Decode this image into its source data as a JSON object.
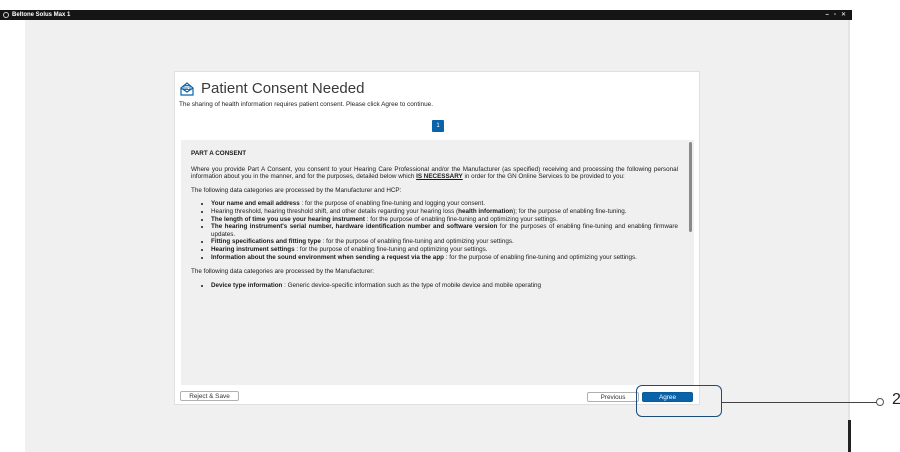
{
  "window": {
    "title": "Beltone Solus Max 1",
    "controls": [
      "–",
      "▫",
      "✕"
    ]
  },
  "dialog": {
    "title": "Patient Consent Needed",
    "subtitle": "The sharing of health information requires patient consent.  Please click Agree to continue.",
    "page_number": "1",
    "icon": "envelope-consent-icon",
    "accent_color": "#0a63a9"
  },
  "consent": {
    "part_title": "PART A CONSENT",
    "intro_pre": "Where you provide Part A Consent, you consent to your Hearing Care Professional and/or the Manufacturer (as specified) receiving and processing the following personal information about you in the manner, and for the purposes, detailed below which ",
    "intro_emph": "IS NECESSARY",
    "intro_post": " in order for the GN Online Services to be provided to you:",
    "hcp_heading": "The following data categories are processed by the Manufacturer and HCP:",
    "hcp_items": [
      {
        "bold": "Your name and email address",
        "text": " : for the purpose of enabling fine-tuning and logging your consent."
      },
      {
        "bold": "",
        "text": "Hearing threshold, hearing threshold shift, and other details regarding your hearing loss (",
        "bold2": "health information",
        "text2": "); for the purpose of enabling fine-tuning."
      },
      {
        "bold": "The length of time you use your hearing instrument",
        "text": " : for the purpose of enabling fine-tuning and optimizing your settings."
      },
      {
        "bold": "The hearing instrument's serial number, hardware identification number and software version",
        "text": "  for the purposes of enabling fine-tuning and enabling firmware updates."
      },
      {
        "bold": "Fitting specifications and fitting type",
        "text": " : for the purpose of enabling fine-tuning and optimizing your settings."
      },
      {
        "bold": "Hearing instrument settings",
        "text": " : for the purpose of enabling fine-tuning and optimizing your settings."
      },
      {
        "bold": "Information about the sound environment when sending a request via the app",
        "text": "  : for the purpose of enabling fine-tuning and optimizing your settings."
      }
    ],
    "mfr_heading": "The following data categories are processed by the Manufacturer:",
    "mfr_items": [
      {
        "bold": "Device type information",
        "text": " : Generic device-specific information such as the type of mobile device and mobile operating"
      }
    ]
  },
  "buttons": {
    "reject": "Reject & Save",
    "previous": "Previous",
    "agree": "Agree"
  },
  "callout": {
    "number": "2"
  }
}
